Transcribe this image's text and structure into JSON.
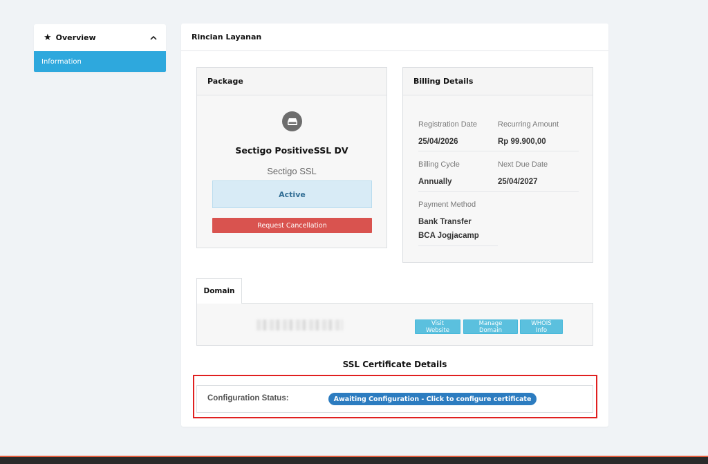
{
  "sidebar": {
    "header": "Overview",
    "header_icon": "star-icon",
    "toggle_icon": "chevron-up-icon",
    "items": [
      {
        "label": "Information",
        "active": true
      }
    ]
  },
  "main": {
    "title": "Rincian Layanan",
    "package": {
      "title": "Package",
      "icon": "server-icon",
      "product_name": "Sectigo PositiveSSL DV",
      "group_name": "Sectigo SSL",
      "status": "Active",
      "cancel_label": "Request Cancellation"
    },
    "billing": {
      "title": "Billing Details",
      "registration_date_label": "Registration Date",
      "registration_date": "25/04/2026",
      "recurring_amount_label": "Recurring Amount",
      "recurring_amount": "Rp 99.900,00",
      "billing_cycle_label": "Billing Cycle",
      "billing_cycle": "Annually",
      "next_due_label": "Next Due Date",
      "next_due": "25/04/2027",
      "payment_method_label": "Payment Method",
      "payment_method": "Bank Transfer BCA Jogjacamp"
    },
    "domain_tab": {
      "label": "Domain",
      "buttons": [
        "Visit Website",
        "Manage Domain",
        "WHOIS Info"
      ]
    },
    "ssl": {
      "title": "SSL Certificate Details",
      "config_label": "Configuration Status:",
      "config_button": "Awaiting Configuration - Click to configure certificate"
    }
  },
  "colors": {
    "accent": "#2ea8dd",
    "danger": "#d9534f",
    "info": "#5bc0de",
    "primary": "#2c7cc0",
    "highlight": "#e02020"
  }
}
